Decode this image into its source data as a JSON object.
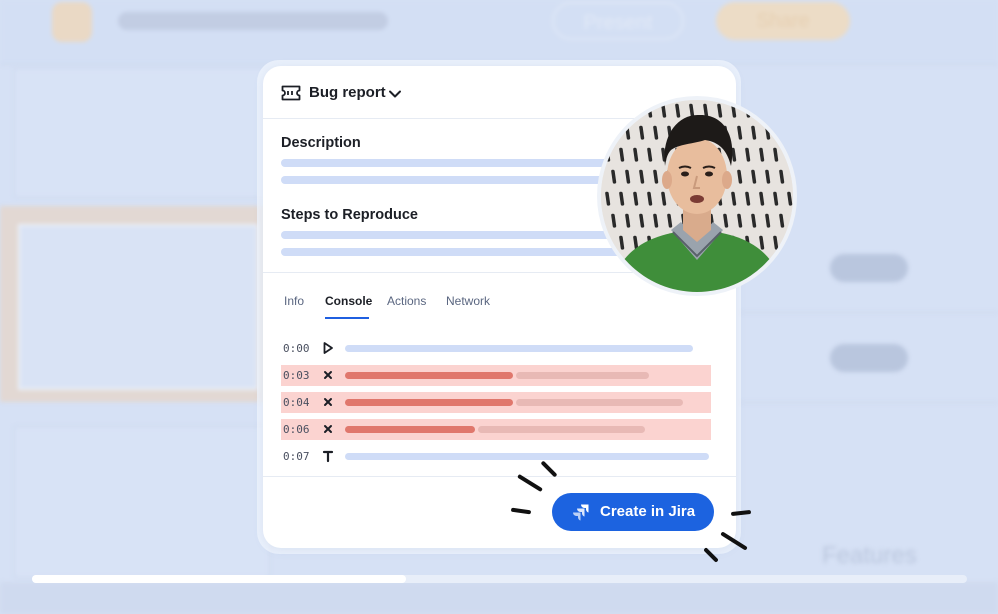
{
  "background": {
    "present_label": "Present",
    "share_label": "Share",
    "features_label": "Features"
  },
  "progress": {
    "fraction": 0.4
  },
  "card": {
    "title": "Bug report",
    "sections": [
      {
        "label": "Description"
      },
      {
        "label": "Steps to Reproduce"
      }
    ],
    "tabs": [
      {
        "label": "Info"
      },
      {
        "label": "Console",
        "active": true
      },
      {
        "label": "Actions"
      },
      {
        "label": "Network"
      }
    ],
    "console_rows": [
      {
        "time": "0:00",
        "icon": "play-icon",
        "type": "normal"
      },
      {
        "time": "0:03",
        "icon": "close-icon",
        "type": "error"
      },
      {
        "time": "0:04",
        "icon": "close-icon",
        "type": "error"
      },
      {
        "time": "0:06",
        "icon": "close-icon",
        "type": "error"
      },
      {
        "time": "0:07",
        "icon": "text-icon",
        "type": "normal"
      }
    ]
  },
  "button": {
    "label": "Create in Jira"
  },
  "colors": {
    "accent": "#1c63e0",
    "error_row": "#fbd3d0",
    "error_bar": "#e0776c",
    "muted_bar": "#cfdcf7"
  }
}
